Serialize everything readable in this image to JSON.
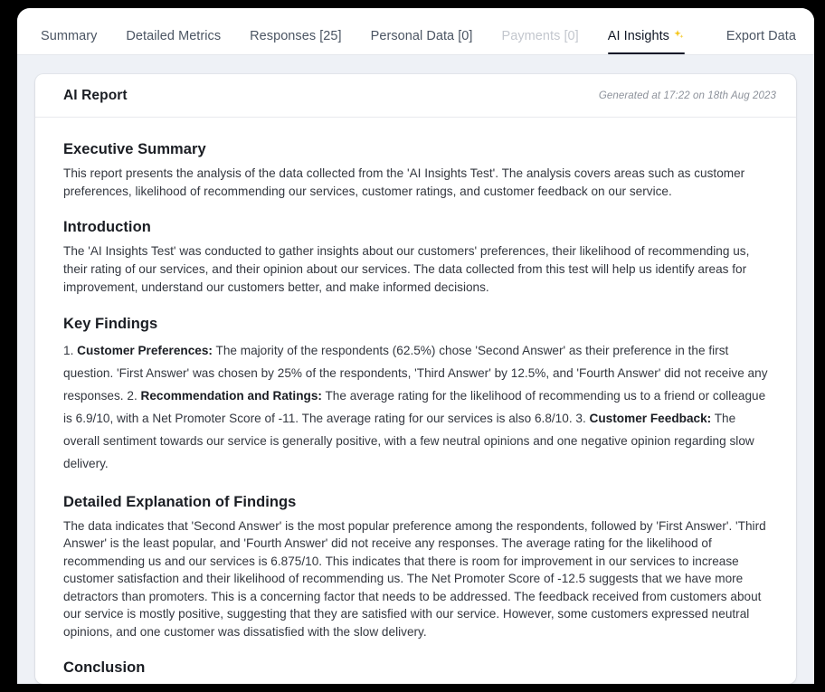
{
  "tabs": [
    {
      "label": "Summary",
      "state": "default",
      "name": "tab-summary"
    },
    {
      "label": "Detailed Metrics",
      "state": "default",
      "name": "tab-detailed-metrics"
    },
    {
      "label": "Responses [25]",
      "state": "default",
      "name": "tab-responses"
    },
    {
      "label": "Personal Data [0]",
      "state": "default",
      "name": "tab-personal-data"
    },
    {
      "label": "Payments [0]",
      "state": "disabled",
      "name": "tab-payments"
    },
    {
      "label": "AI Insights",
      "state": "active",
      "name": "tab-ai-insights",
      "icon": "sparkle-icon"
    },
    {
      "label": "Export Data",
      "state": "default",
      "name": "tab-export-data"
    }
  ],
  "report": {
    "title": "AI Report",
    "generated": "Generated at 17:22 on 18th Aug 2023",
    "sections": {
      "executive_summary": {
        "heading": "Executive Summary",
        "body": "This report presents the analysis of the data collected from the 'AI Insights Test'. The analysis covers areas such as customer preferences, likelihood of recommending our services, customer ratings, and customer feedback on our service."
      },
      "introduction": {
        "heading": "Introduction",
        "body": "The 'AI Insights Test' was conducted to gather insights about our customers' preferences, their likelihood of recommending us, their rating of our services, and their opinion about our services. The data collected from this test will help us identify areas for improvement, understand our customers better, and make informed decisions."
      },
      "key_findings": {
        "heading": "Key Findings",
        "item1_number": "1. ",
        "item1_label": "Customer Preferences:",
        "item1_body": " The majority of the respondents (62.5%) chose 'Second Answer' as their preference in the first question. 'First Answer' was chosen by 25% of the respondents, 'Third Answer' by 12.5%, and 'Fourth Answer' did not receive any responses. 2. ",
        "item2_label": "Recommendation and Ratings:",
        "item2_body": " The average rating for the likelihood of recommending us to a friend or colleague is 6.9/10, with a Net Promoter Score of -11. The average rating for our services is also 6.8/10. 3. ",
        "item3_label": "Customer Feedback:",
        "item3_body": " The overall sentiment towards our service is generally positive, with a few neutral opinions and one negative opinion regarding slow delivery."
      },
      "detailed_explanation": {
        "heading": "Detailed Explanation of Findings",
        "body": "The data indicates that 'Second Answer' is the most popular preference among the respondents, followed by 'First Answer'. 'Third Answer' is the least popular, and 'Fourth Answer' did not receive any responses. The average rating for the likelihood of recommending us and our services is 6.875/10. This indicates that there is room for improvement in our services to increase customer satisfaction and their likelihood of recommending us. The Net Promoter Score of -12.5 suggests that we have more detractors than promoters. This is a concerning factor that needs to be addressed. The feedback received from customers about our service is mostly positive, suggesting that they are satisfied with our service. However, some customers expressed neutral opinions, and one customer was dissatisfied with the slow delivery."
      },
      "conclusion": {
        "heading": "Conclusion"
      }
    }
  },
  "colors": {
    "page_background": "#eef1f6",
    "card_background": "#ffffff",
    "active_tab": "#111827",
    "disabled_tab": "#c3c7ce",
    "sparkle": "#f5c518",
    "frame": "#000000"
  }
}
